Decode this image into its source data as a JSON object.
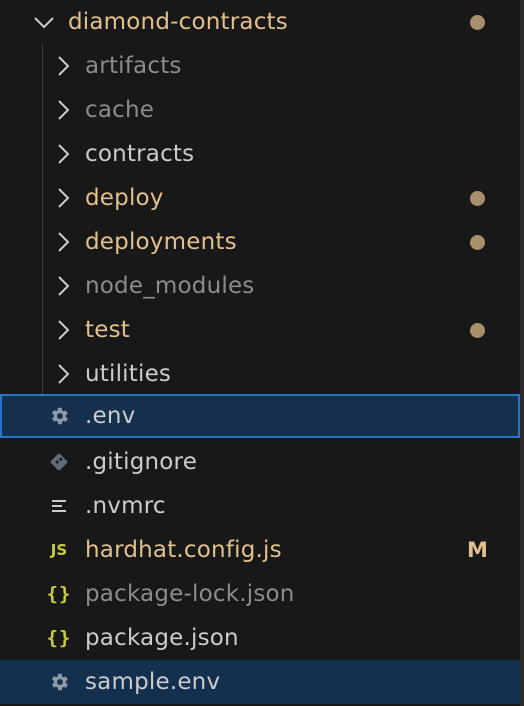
{
  "explorer": {
    "root": {
      "label": "diamond-contracts",
      "color": "#e2c08d",
      "decoration": "modified-dot"
    },
    "folders": [
      {
        "label": "artifacts",
        "color": "#8c8c8c"
      },
      {
        "label": "cache",
        "color": "#8c8c8c"
      },
      {
        "label": "contracts",
        "color": "#cccccc"
      },
      {
        "label": "deploy",
        "color": "#e2c08d",
        "decoration": "modified-dot"
      },
      {
        "label": "deployments",
        "color": "#e2c08d",
        "decoration": "modified-dot"
      },
      {
        "label": "node_modules",
        "color": "#8c8c8c"
      },
      {
        "label": "test",
        "color": "#e2c08d",
        "decoration": "modified-dot"
      },
      {
        "label": "utilities",
        "color": "#cccccc"
      }
    ],
    "files": [
      {
        "label": ".env",
        "icon": "gear-icon",
        "color": "#cccccc",
        "state": "selected"
      },
      {
        "label": ".gitignore",
        "icon": "git-icon",
        "color": "#cccccc"
      },
      {
        "label": ".nvmrc",
        "icon": "lines-icon",
        "color": "#cccccc"
      },
      {
        "label": "hardhat.config.js",
        "icon": "js-icon",
        "icon_text": "JS",
        "color": "#e2c08d",
        "badge": "M"
      },
      {
        "label": "package-lock.json",
        "icon": "json-icon",
        "icon_text": "{}",
        "color": "#8c8c8c"
      },
      {
        "label": "package.json",
        "icon": "json-icon",
        "icon_text": "{}",
        "color": "#cccccc"
      },
      {
        "label": "sample.env",
        "icon": "gear-icon",
        "color": "#cccccc",
        "state": "highlighted"
      }
    ]
  },
  "colors": {
    "background": "#181818",
    "selection_background": "#14304d",
    "selection_border": "#2a73c8",
    "modified": "#e2c08d",
    "ignored": "#8c8c8c",
    "default_text": "#cccccc",
    "js_icon": "#cbcb41",
    "json_icon": "#cbcb41",
    "gear_icon": "#8e9aa6"
  }
}
